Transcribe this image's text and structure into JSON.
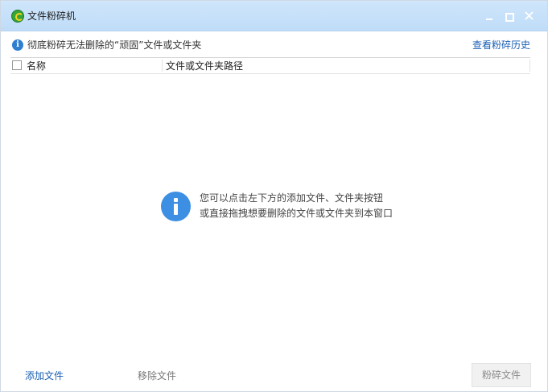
{
  "window": {
    "title": "文件粉碎机",
    "logo_icon": "shredder-app-logo"
  },
  "info_bar": {
    "text": "彻底粉碎无法删除的“顽固”文件或文件夹",
    "history_link": "查看粉碎历史"
  },
  "table": {
    "columns": [
      "名称",
      "文件或文件夹路径"
    ],
    "rows": []
  },
  "empty_state": {
    "line1": "您可以点击左下方的添加文件、文件夹按钮",
    "line2": "或直接拖拽想要删除的文件或文件夹到本窗口"
  },
  "footer": {
    "add_file": "添加文件",
    "remove_file": "移除文件",
    "shred_button": "粉碎文件"
  },
  "colors": {
    "titlebar": "#bfdcf8",
    "link": "#1a5fb4",
    "info_icon": "#3c8fe3",
    "disabled_text": "#8a8a8a"
  }
}
